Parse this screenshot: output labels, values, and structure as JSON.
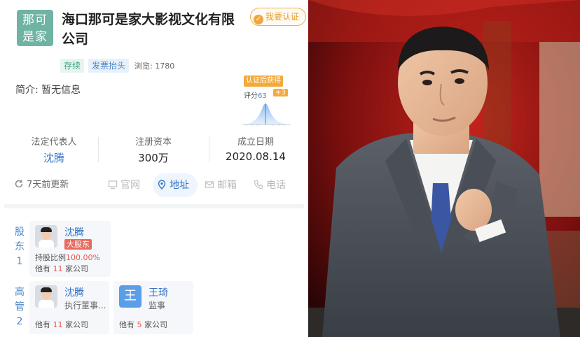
{
  "company": {
    "logo_text_line1": "那可",
    "logo_text_line2": "是家",
    "name": "海口那可是家大影视文化有限公司",
    "verify_button": "我要认证",
    "status_tag": "存续",
    "invoice_tag": "发票抬头",
    "views": "浏览: 1780",
    "intro": "简介:  暂无信息"
  },
  "score": {
    "badge": "认证后获得",
    "label": "评分",
    "value": "63",
    "plus": "+3"
  },
  "stats": [
    {
      "label": "法定代表人",
      "value": "沈腾"
    },
    {
      "label": "注册资本",
      "value": "300万"
    },
    {
      "label": "成立日期",
      "value": "2020.08.14"
    }
  ],
  "actions": {
    "update": "7天前更新",
    "website": "官网",
    "address": "地址",
    "email": "邮箱",
    "phone": "电话"
  },
  "shareholder": {
    "section_label": [
      "股",
      "东",
      "1"
    ],
    "name": "沈腾",
    "badge": "大股东",
    "share_label": "持股比例",
    "share_value": "100.00%",
    "company_count_prefix": "他有 ",
    "company_count": "11",
    "company_count_suffix": " 家公司"
  },
  "executives": {
    "section_label": [
      "高",
      "管",
      "2"
    ],
    "items": [
      {
        "name": "沈腾",
        "role": "执行董事...",
        "count_prefix": "他有 ",
        "count": "11",
        "count_suffix": " 家公司"
      },
      {
        "name": "王琦",
        "avatar_text": "王",
        "role": "监事",
        "count_prefix": "他有 ",
        "count": "5",
        "count_suffix": " 家公司"
      }
    ]
  },
  "colors": {
    "brand_green": "#6fb3a4",
    "link_blue": "#2f74c6",
    "accent_orange": "#f0a63a",
    "alert_red": "#e8574a"
  }
}
